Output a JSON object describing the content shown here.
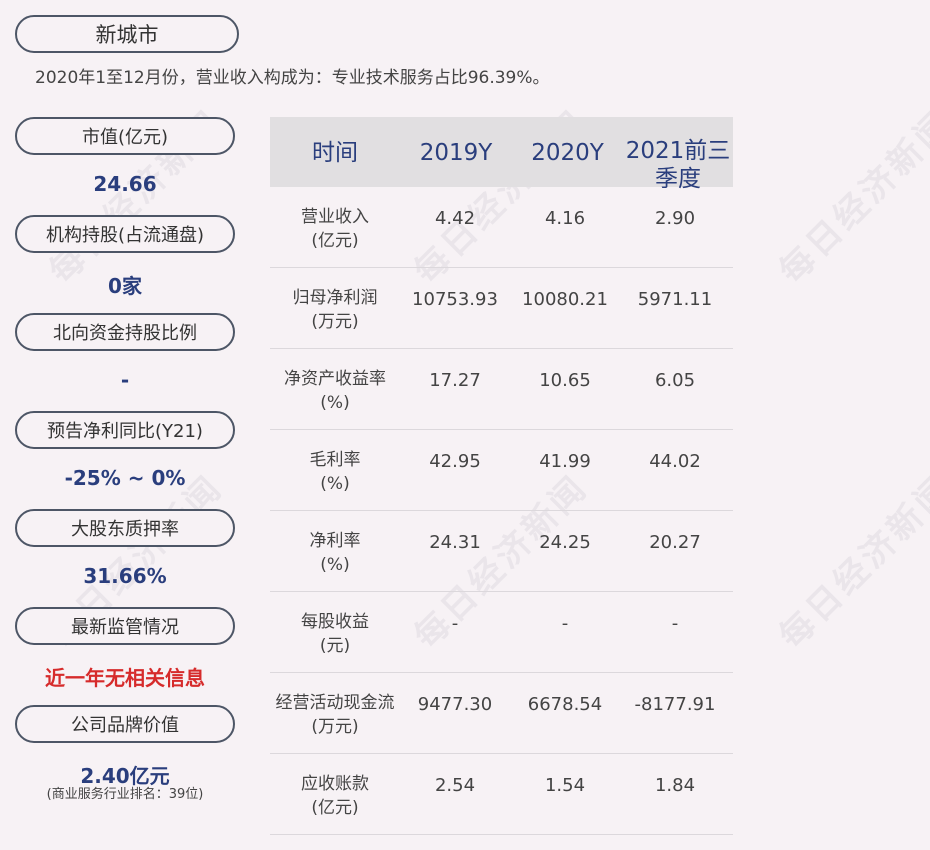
{
  "header": {
    "title": "新城市",
    "subtitle": "2020年1至12月份，营业收入构成为：专业技术服务占比96.39%。"
  },
  "metrics": [
    {
      "label": "市值(亿元)",
      "value": "24.66"
    },
    {
      "label": "机构持股(占流通盘)",
      "value": "0家"
    },
    {
      "label": "北向资金持股比例",
      "value": "-"
    },
    {
      "label": "预告净利同比(Y21)",
      "value": "-25% ~ 0%"
    },
    {
      "label": "大股东质押率",
      "value": "31.66%"
    },
    {
      "label": "最新监管情况",
      "value": "近一年无相关信息"
    },
    {
      "label": "公司品牌价值",
      "value": "2.40亿元",
      "note": "(商业服务行业排名：39位)"
    }
  ],
  "table": {
    "headers": [
      "时间",
      "2019Y",
      "2020Y",
      "2021前三\n季度"
    ],
    "header_lines": [
      "2021前三",
      "季度"
    ],
    "rows": [
      {
        "label": [
          "营业收入",
          "(亿元)"
        ],
        "values": [
          "4.42",
          "4.16",
          "2.90"
        ]
      },
      {
        "label": [
          "归母净利润",
          "(万元)"
        ],
        "values": [
          "10753.93",
          "10080.21",
          "5971.11"
        ]
      },
      {
        "label": [
          "净资产收益率",
          "(%)"
        ],
        "values": [
          "17.27",
          "10.65",
          "6.05"
        ]
      },
      {
        "label": [
          "毛利率",
          "(%)"
        ],
        "values": [
          "42.95",
          "41.99",
          "44.02"
        ]
      },
      {
        "label": [
          "净利率",
          "(%)"
        ],
        "values": [
          "24.31",
          "24.25",
          "20.27"
        ]
      },
      {
        "label": [
          "每股收益",
          "(元)"
        ],
        "values": [
          "-",
          "-",
          "-"
        ]
      },
      {
        "label": [
          "经营活动现金流",
          "(万元)"
        ],
        "values": [
          "9477.30",
          "6678.54",
          "-8177.91"
        ]
      },
      {
        "label": [
          "应收账款",
          "(亿元)"
        ],
        "values": [
          "2.54",
          "1.54",
          "1.84"
        ]
      }
    ]
  },
  "watermark": "每日经济新闻",
  "colors": {
    "accent": "#2a3e7d",
    "alert": "#d62b2b",
    "background": "#f7f2f5",
    "header_bg": "#e1dfe1"
  }
}
